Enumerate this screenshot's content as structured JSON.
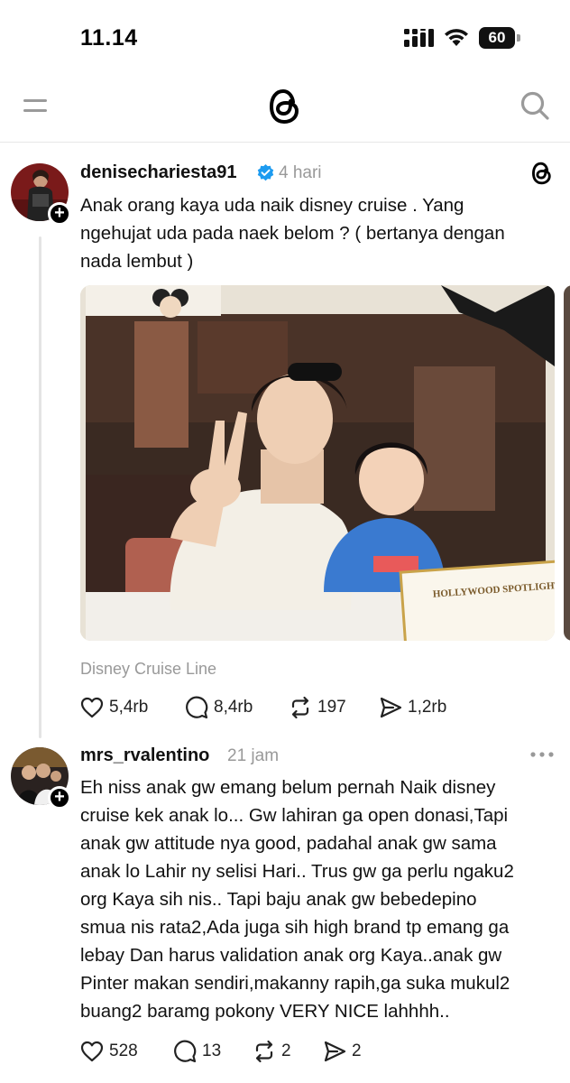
{
  "status": {
    "time": "11.14",
    "battery": "60"
  },
  "header": {
    "menu_icon": "menu-icon",
    "logo_icon": "threads-logo-icon",
    "search_icon": "search-icon"
  },
  "posts": [
    {
      "username": "denisechariesta91",
      "verified": true,
      "time": "4 hari",
      "text_lines": [
        "Anak orang kaya uda naik disney cruise . Yang",
        "ngehujat uda pada naek belom ? ( bertanya dengan",
        "nada lembut )"
      ],
      "image_texts": {
        "certificate_title": "HOLLYWOOD SPOTLIGHT CL"
      },
      "caption": "Disney Cruise Line",
      "likes": "5,4rb",
      "replies": "8,4rb",
      "reposts": "197",
      "shares": "1,2rb"
    },
    {
      "username": "mrs_rvalentino",
      "time": "21 jam",
      "text_lines": [
        "Eh niss anak gw emang belum pernah Naik disney",
        "cruise kek anak lo... Gw lahiran ga open donasi,Tapi",
        "anak gw attitude nya good, padahal anak gw sama",
        "anak lo Lahir ny selisi Hari.. Trus gw ga perlu ngaku2",
        "org Kaya sih nis.. Tapi baju anak gw bebedepino",
        "smua nis rata2,Ada juga sih high brand tp emang ga",
        "lebay Dan harus validation anak org Kaya..anak gw",
        "Pinter makan sendiri,makanny rapih,ga suka mukul2",
        "buang2 baramg pokony VERY NICE lahhhh.."
      ],
      "likes": "528",
      "replies": "13",
      "reposts": "2",
      "shares": "2"
    }
  ]
}
